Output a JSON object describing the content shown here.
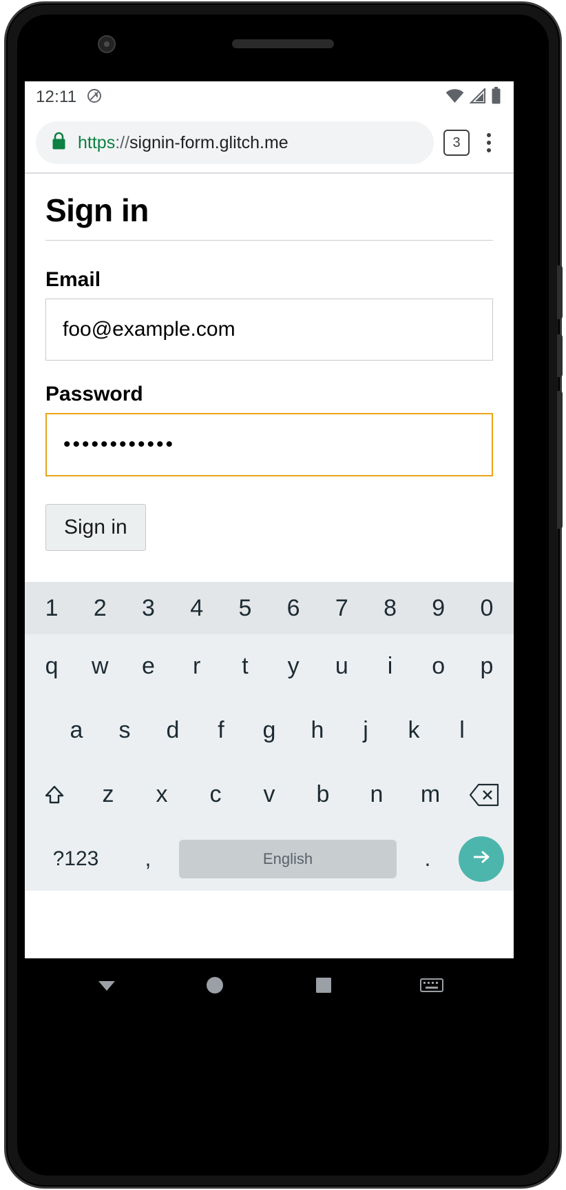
{
  "status_bar": {
    "clock": "12:11",
    "icons": [
      "do-not-disturb-icon",
      "wifi-icon",
      "cell-signal-icon",
      "battery-icon"
    ]
  },
  "browser": {
    "url_scheme": "https",
    "url_separator": "://",
    "url_host": "signin-form.glitch.me",
    "full_url": "https://signin-form.glitch.me",
    "tab_count": "3",
    "lock_icon": "lock-icon",
    "menu_icon": "overflow-menu-icon"
  },
  "page": {
    "title": "Sign in",
    "email": {
      "label": "Email",
      "value": "foo@example.com",
      "placeholder": ""
    },
    "password": {
      "label": "Password",
      "value": "••••••••••••",
      "masked_char_count": 12,
      "focused": true,
      "focus_color": "#e8a317"
    },
    "submit_label": "Sign in"
  },
  "keyboard": {
    "numbers": [
      "1",
      "2",
      "3",
      "4",
      "5",
      "6",
      "7",
      "8",
      "9",
      "0"
    ],
    "row_q": [
      "q",
      "w",
      "e",
      "r",
      "t",
      "y",
      "u",
      "i",
      "o",
      "p"
    ],
    "row_a": [
      "a",
      "s",
      "d",
      "f",
      "g",
      "h",
      "j",
      "k",
      "l"
    ],
    "row_z": [
      "z",
      "x",
      "c",
      "v",
      "b",
      "n",
      "m"
    ],
    "shift_icon": "shift-icon",
    "backspace_icon": "backspace-icon",
    "symbols_label": "?123",
    "comma_label": ",",
    "space_label": "English",
    "period_label": ".",
    "enter_icon": "arrow-right-icon",
    "enter_color": "#4db6ac"
  },
  "nav_bar": {
    "back_icon": "back-triangle-icon",
    "home_icon": "home-circle-icon",
    "recents_icon": "recents-square-icon",
    "keyboard_icon": "keyboard-icon"
  }
}
